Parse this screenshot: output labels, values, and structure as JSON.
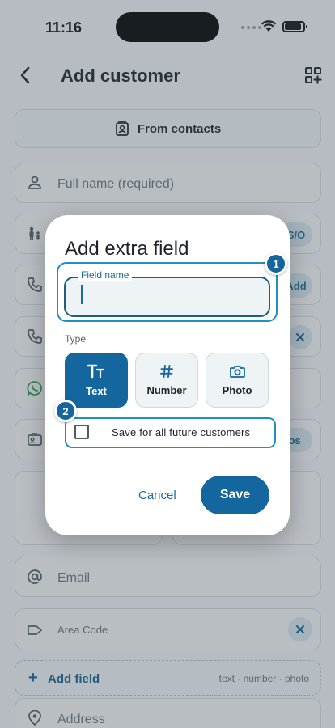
{
  "status_bar": {
    "time": "11:16"
  },
  "header": {
    "title": "Add customer"
  },
  "form": {
    "from_contacts_label": "From contacts",
    "full_name_placeholder": "Full name (required)",
    "relation_pill": "S/O",
    "phone_pill": "Add",
    "photos_pill": "tos",
    "email_placeholder": "Email",
    "area_code_placeholder": "Area Code",
    "add_field_label": "Add field",
    "add_field_hint": "text · number · photo",
    "address_placeholder": "Address"
  },
  "dialog": {
    "title": "Add extra field",
    "field_name_label": "Field name",
    "field_name_value": "",
    "type_label": "Type",
    "types": [
      {
        "label": "Text",
        "icon": "text-type-icon",
        "selected": true
      },
      {
        "label": "Number",
        "icon": "hash-icon",
        "selected": false
      },
      {
        "label": "Photo",
        "icon": "camera-icon",
        "selected": false
      }
    ],
    "save_for_all_label": "Save for all future customers",
    "save_for_all_checked": false,
    "cancel_label": "Cancel",
    "save_label": "Save"
  },
  "annotations": {
    "badge_1": "1",
    "badge_2": "2"
  },
  "colors": {
    "accent": "#13679e",
    "highlight": "#1f8fc4",
    "accent_light": "#d7e6ee"
  }
}
